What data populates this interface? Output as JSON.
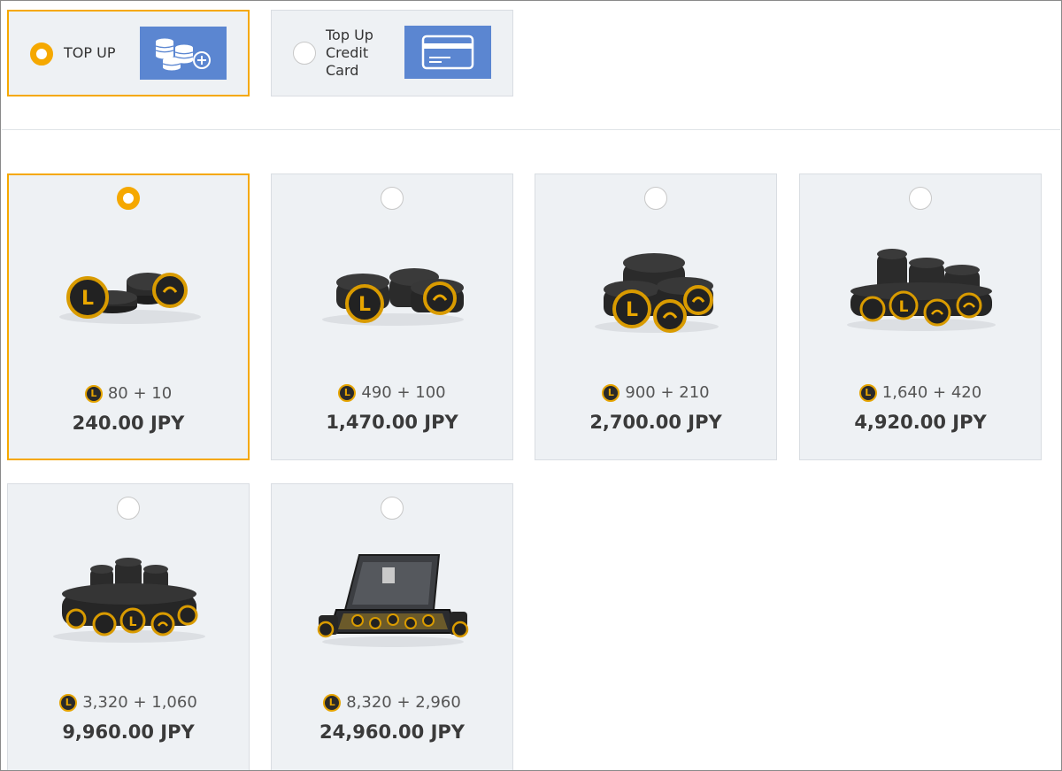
{
  "payment_methods": [
    {
      "label": "TOP UP",
      "selected": true,
      "icon": "coins-plus-icon"
    },
    {
      "label": "Top Up Credit Card",
      "selected": false,
      "icon": "credit-card-icon"
    }
  ],
  "currency_icon": "L",
  "packages": [
    {
      "amount": "80 + 10",
      "price": "240.00 JPY",
      "selected": true,
      "art": "small-coin-pile-icon"
    },
    {
      "amount": "490 + 100",
      "price": "1,470.00 JPY",
      "selected": false,
      "art": "coin-stacks-icon"
    },
    {
      "amount": "900 + 210",
      "price": "2,700.00 JPY",
      "selected": false,
      "art": "coin-heap-icon"
    },
    {
      "amount": "1,640 + 420",
      "price": "4,920.00 JPY",
      "selected": false,
      "art": "large-coin-heap-icon"
    },
    {
      "amount": "3,320 + 1,060",
      "price": "9,960.00 JPY",
      "selected": false,
      "art": "huge-coin-pile-icon"
    },
    {
      "amount": "8,320 + 2,960",
      "price": "24,960.00 JPY",
      "selected": false,
      "art": "coin-briefcase-icon"
    }
  ],
  "colors": {
    "accent": "#f5a800",
    "card_bg": "#eef1f4",
    "method_thumb": "#5b86d1"
  }
}
